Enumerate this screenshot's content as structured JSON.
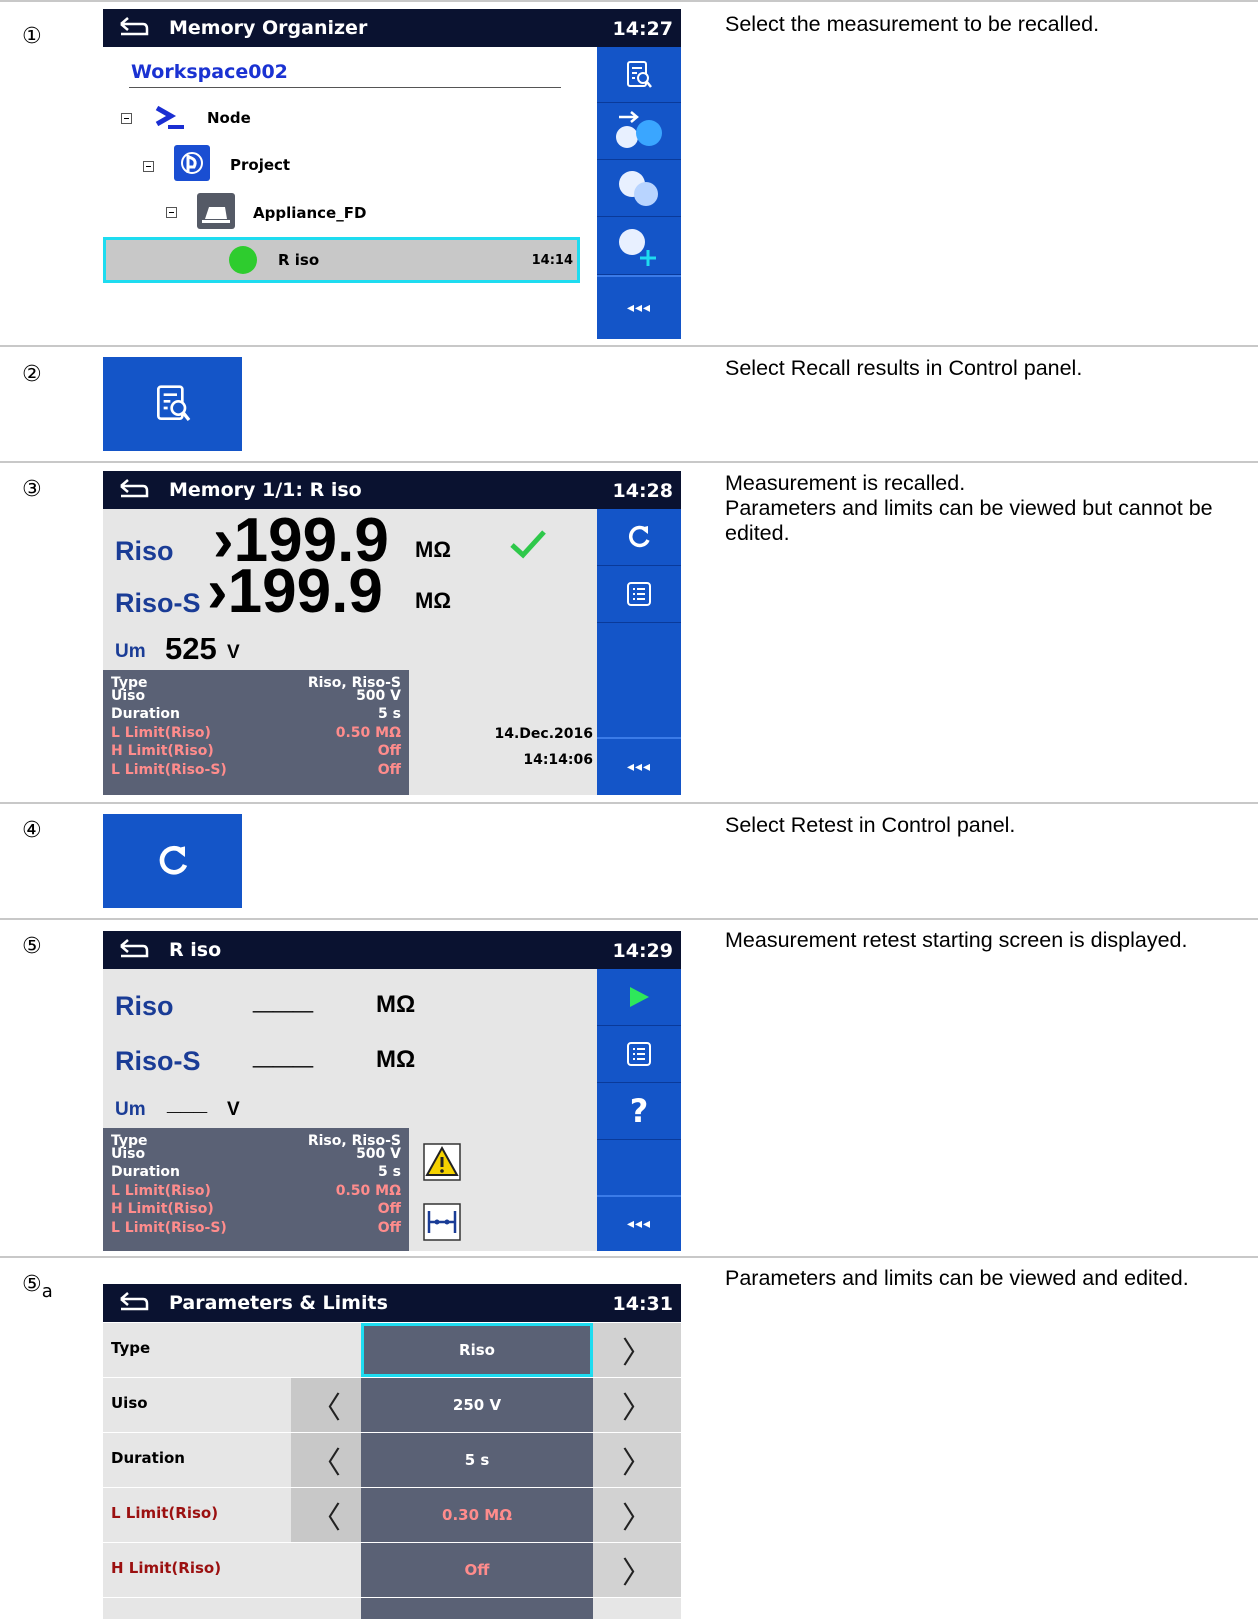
{
  "steps": [
    {
      "num": "①",
      "sub": "",
      "desc": "Select the measurement to be recalled."
    },
    {
      "num": "②",
      "sub": "",
      "desc": "Select Recall results in Control panel."
    },
    {
      "num": "③",
      "sub": "",
      "desc": "Measurement is recalled.\nParameters and limits can be viewed but cannot be edited."
    },
    {
      "num": "④",
      "sub": "",
      "desc": "Select Retest in Control panel."
    },
    {
      "num": "⑤",
      "sub": "",
      "desc": "Measurement retest starting screen is displayed."
    },
    {
      "num": "⑤",
      "sub": "a",
      "desc": "Parameters and limits can be viewed and edited."
    }
  ],
  "screen1": {
    "title": "Memory Organizer",
    "time": "14:27",
    "workspace": "Workspace002",
    "tree": {
      "node": "Node",
      "project": "Project",
      "appliance": "Appliance_FD",
      "measurement": "R iso",
      "measurement_time": "14:14"
    },
    "more": "◂◂◂"
  },
  "screen3": {
    "title": "Memory 1/1: R iso",
    "time": "14:28",
    "riso_label": "Riso",
    "riso_value": "199.9",
    "riso_unit": "MΩ",
    "risos_label": "Riso-S",
    "risos_value": "199.9",
    "risos_unit": "MΩ",
    "um_label": "Um",
    "um_value": "525",
    "um_unit": "V",
    "prefix": "›",
    "params": [
      {
        "k": "Type",
        "v": "Riso, Riso-S"
      },
      {
        "k": "Uiso",
        "v": "500 V"
      },
      {
        "k": "Duration",
        "v": "5 s"
      },
      {
        "k": "L Limit(Riso)",
        "v": "0.50 MΩ"
      },
      {
        "k": "H Limit(Riso)",
        "v": "Off"
      },
      {
        "k": "L Limit(Riso-S)",
        "v": "Off"
      }
    ],
    "date": "14.Dec.2016",
    "clock": "14:14:06",
    "more": "◂◂◂"
  },
  "screen5": {
    "title": "R iso",
    "time": "14:29",
    "riso_label": "Riso",
    "risos_label": "Riso-S",
    "um_label": "Um",
    "dash3": "___",
    "unit_mohm": "MΩ",
    "unit_v": "V",
    "params": [
      {
        "k": "Type",
        "v": "Riso, Riso-S"
      },
      {
        "k": "Uiso",
        "v": "500 V"
      },
      {
        "k": "Duration",
        "v": "5 s"
      },
      {
        "k": "L Limit(Riso)",
        "v": "0.50 MΩ"
      },
      {
        "k": "H Limit(Riso)",
        "v": "Off"
      },
      {
        "k": "L Limit(Riso-S)",
        "v": "Off"
      }
    ],
    "help": "?",
    "more": "◂◂◂"
  },
  "screen6": {
    "title": "Parameters & Limits",
    "time": "14:31",
    "rows": [
      {
        "name": "Type",
        "value": "Riso"
      },
      {
        "name": "Uiso",
        "value": "250 V"
      },
      {
        "name": "Duration",
        "value": "5 s"
      },
      {
        "name": "L Limit(Riso)",
        "value": "0.30 MΩ"
      },
      {
        "name": "H Limit(Riso)",
        "value": "Off"
      }
    ],
    "left_arrow": "〈",
    "right_arrow": "〉"
  },
  "colors": {
    "title_bg": "#0a1230",
    "panel_blue": "#1455c8",
    "highlight": "#1edcf0",
    "info_bg": "#5a6175"
  }
}
